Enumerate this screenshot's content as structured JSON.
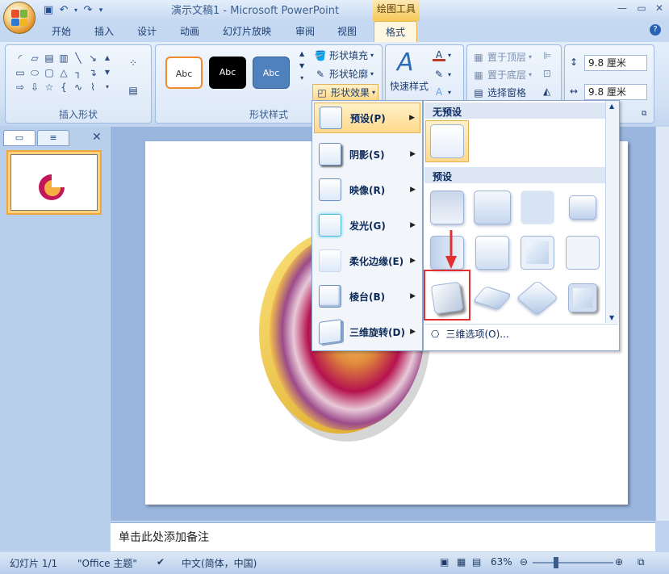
{
  "titlebar": {
    "doc_title": "演示文稿1 - Microsoft PowerPoint",
    "tool_title": "绘图工具"
  },
  "tabs": [
    "开始",
    "插入",
    "设计",
    "动画",
    "幻灯片放映",
    "审阅",
    "视图",
    "格式"
  ],
  "ribbon": {
    "insert_shapes_label": "插入形状",
    "shape_styles_label": "形状样式",
    "style_samples": [
      "Abc",
      "Abc",
      "Abc"
    ],
    "fill_label": "形状填充",
    "outline_label": "形状轮廓",
    "effects_label": "形状效果",
    "quick_styles_label": "快速样式",
    "bring_front_label": "置于顶层",
    "send_back_label": "置于底层",
    "selection_pane_label": "选择窗格",
    "height_value": "9.8 厘米",
    "width_value": "9.8 厘米"
  },
  "effects_menu": {
    "items": [
      {
        "label": "预设(P)"
      },
      {
        "label": "阴影(S)"
      },
      {
        "label": "映像(R)"
      },
      {
        "label": "发光(G)"
      },
      {
        "label": "柔化边缘(E)"
      },
      {
        "label": "棱台(B)"
      },
      {
        "label": "三维旋转(D)"
      }
    ]
  },
  "preset_gallery": {
    "no_preset_header": "无预设",
    "preset_header": "预设",
    "options_label": "三维选项(O)..."
  },
  "slide_pane": {
    "slide_number": "1"
  },
  "notes": {
    "placeholder": "单击此处添加备注"
  },
  "statusbar": {
    "slide_info": "幻灯片 1/1",
    "theme": "\"Office 主题\"",
    "language": "中文(简体，中国)",
    "zoom": "63%"
  },
  "colors": {
    "accent": "#f6c757",
    "highlight": "#e03030",
    "ribbon": "#d3e1f4"
  }
}
